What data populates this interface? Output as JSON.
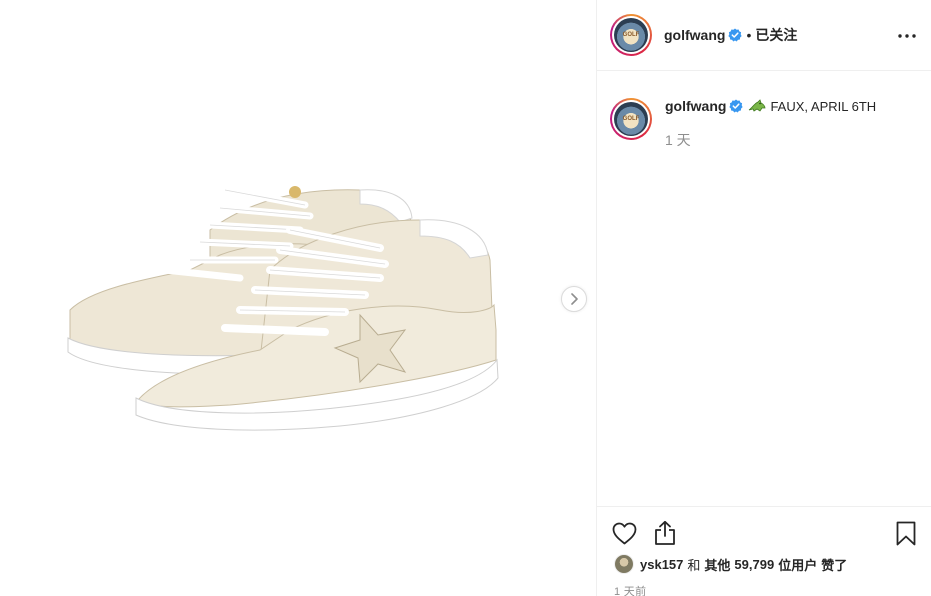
{
  "header": {
    "username": "golfwang",
    "separator": "•",
    "follow_label": "已关注",
    "avatar_text": "GOLF"
  },
  "caption": {
    "username": "golfwang",
    "text": "FAUX, APRIL 6TH",
    "icon": "alligator-emoji",
    "time": "1 天"
  },
  "actions": {
    "like_icon": "heart-icon",
    "share_icon": "share-icon",
    "save_icon": "bookmark-icon"
  },
  "likes": {
    "first_user": "ysk157",
    "connector": "和",
    "others_label": "其他",
    "count": "59,799",
    "users_label": "位用户",
    "liked_label": "赞了"
  },
  "post_time": "1 天前",
  "colors": {
    "verified": "#3897f0",
    "text": "#262626",
    "muted": "#8e8e8e",
    "border": "#efefef"
  }
}
